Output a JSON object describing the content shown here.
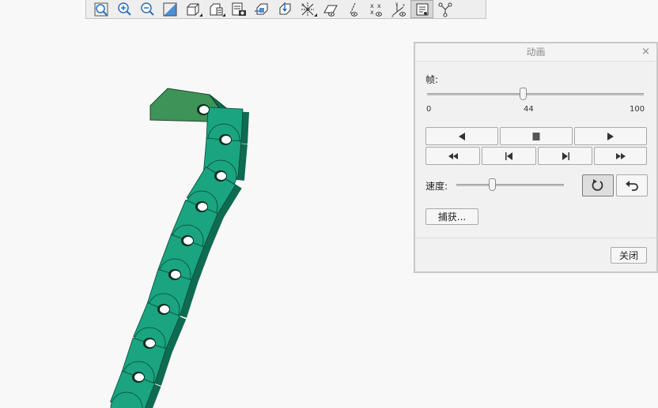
{
  "toolbar": {
    "buttons": [
      {
        "icon": "refit-icon",
        "active": false
      },
      {
        "icon": "zoom-in-icon",
        "active": false
      },
      {
        "icon": "zoom-out-icon",
        "active": false
      },
      {
        "icon": "repaint-icon",
        "active": false
      },
      {
        "icon": "display-style-icon",
        "active": false
      },
      {
        "icon": "saved-orientations-icon",
        "active": false
      },
      {
        "icon": "view-manager-icon",
        "active": false
      },
      {
        "icon": "section-icon",
        "active": false
      },
      {
        "icon": "appearance-icon",
        "active": false
      },
      {
        "icon": "datum-display-icon",
        "active": false
      },
      {
        "icon": "plane-display-icon",
        "active": false
      },
      {
        "icon": "axis-display-icon",
        "active": false
      },
      {
        "icon": "point-display-icon",
        "active": false
      },
      {
        "icon": "csys-display-icon",
        "active": false
      },
      {
        "icon": "spin-center-icon",
        "active": true
      },
      {
        "icon": "annotation-display-icon",
        "active": false
      }
    ]
  },
  "model": {
    "description_colors": {
      "chain": "#1aa47f",
      "chain_dark": "#0e6b52",
      "end_link": "#3d9358"
    }
  },
  "dialog": {
    "title": "动画",
    "close_symbol": "×",
    "frame_label": "帧:",
    "frame": {
      "min": "0",
      "value": "44",
      "max": "100",
      "fraction": 0.44
    },
    "speed_label": "速度:",
    "speed_fraction": 0.33,
    "capture_label": "捕获...",
    "close_label": "关闭",
    "icons": {
      "play_back": "play-backward-icon",
      "stop": "stop-icon",
      "play_fwd": "play-forward-icon",
      "rewind": "rewind-icon",
      "step_back": "step-backward-icon",
      "step_fwd": "step-forward-icon",
      "fast_fwd": "fast-forward-icon",
      "loop": "loop-icon",
      "reverse": "reverse-icon"
    }
  }
}
